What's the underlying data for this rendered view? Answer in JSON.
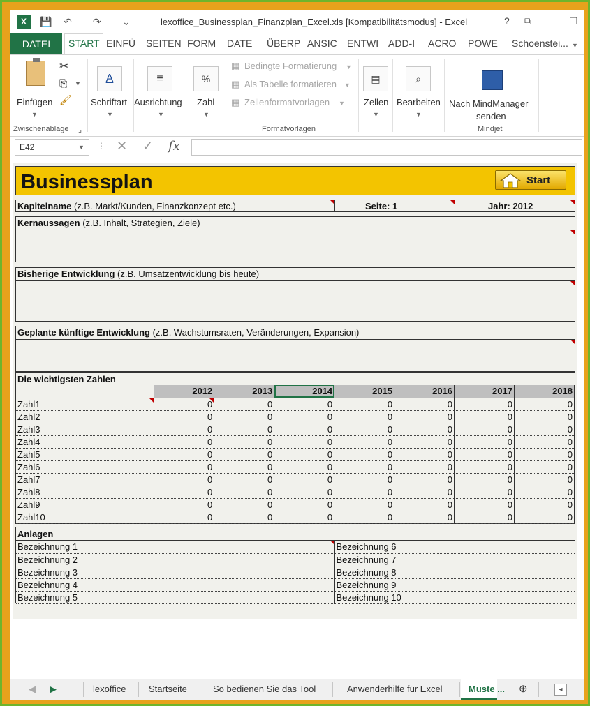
{
  "window": {
    "title": "lexoffice_Businessplan_Finanzplan_Excel.xls  [Kompatibilitätsmodus] - Excel",
    "logo_text": "X",
    "help": "?",
    "restore": "⧉",
    "minimize": "—",
    "maximize": "☐"
  },
  "quick_access": {
    "save": "💾",
    "undo": "↶",
    "redo": "↷",
    "more": "⌄"
  },
  "ribbon_tabs": [
    "DATEI",
    "START",
    "EINFÜ",
    "SEITEN",
    "FORM",
    "DATE",
    "ÜBERP",
    "ANSIC",
    "ENTWI",
    "ADD-I",
    "ACRO",
    "POWE"
  ],
  "account": "Schoenstei...",
  "ribbon": {
    "paste": "Einfügen",
    "clipboard_group": "Zwischenablage",
    "font": "Schriftart",
    "alignment": "Ausrichtung",
    "number": "Zahl",
    "cond_format": "Bedingte Formatierung",
    "as_table": "Als Tabelle formatieren",
    "cell_styles": "Zellenformatvorlagen",
    "styles_group": "Formatvorlagen",
    "cells": "Zellen",
    "edit": "Bearbeiten",
    "mindmanager_line1": "Nach MindManager",
    "mindmanager_line2": "senden",
    "mindjet_group": "Mindjet"
  },
  "formula_bar": {
    "name_box": "E42",
    "cancel": "✕",
    "enter": "✓",
    "fx": "fx",
    "value": ""
  },
  "sheet": {
    "title": "Businessplan",
    "start_button": "Start",
    "kapitel_label": "Kapitelname",
    "kapitel_hint": "(z.B. Markt/Kunden, Finanzkonzept etc.)",
    "seite": "Seite: 1",
    "jahr": "Jahr: 2012",
    "kern_label": "Kernaussagen",
    "kern_hint": "(z.B. Inhalt, Strategien, Ziele)",
    "bisher_label": "Bisherige Entwicklung",
    "bisher_hint": "(z.B. Umsatzentwicklung bis heute)",
    "geplant_label": "Geplante künftige Entwicklung",
    "geplant_hint": "(z.B. Wachstumsraten, Veränderungen, Expansion)",
    "zahlen_title": "Die wichtigsten Zahlen",
    "years": [
      "2012",
      "2013",
      "2014",
      "2015",
      "2016",
      "2017",
      "2018"
    ],
    "rows": [
      {
        "label": "Zahl1",
        "values": [
          "0",
          "0",
          "0",
          "0",
          "0",
          "0",
          "0"
        ]
      },
      {
        "label": "Zahl2",
        "values": [
          "0",
          "0",
          "0",
          "0",
          "0",
          "0",
          "0"
        ]
      },
      {
        "label": "Zahl3",
        "values": [
          "0",
          "0",
          "0",
          "0",
          "0",
          "0",
          "0"
        ]
      },
      {
        "label": "Zahl4",
        "values": [
          "0",
          "0",
          "0",
          "0",
          "0",
          "0",
          "0"
        ]
      },
      {
        "label": "Zahl5",
        "values": [
          "0",
          "0",
          "0",
          "0",
          "0",
          "0",
          "0"
        ]
      },
      {
        "label": "Zahl6",
        "values": [
          "0",
          "0",
          "0",
          "0",
          "0",
          "0",
          "0"
        ]
      },
      {
        "label": "Zahl7",
        "values": [
          "0",
          "0",
          "0",
          "0",
          "0",
          "0",
          "0"
        ]
      },
      {
        "label": "Zahl8",
        "values": [
          "0",
          "0",
          "0",
          "0",
          "0",
          "0",
          "0"
        ]
      },
      {
        "label": "Zahl9",
        "values": [
          "0",
          "0",
          "0",
          "0",
          "0",
          "0",
          "0"
        ]
      },
      {
        "label": "Zahl10",
        "values": [
          "0",
          "0",
          "0",
          "0",
          "0",
          "0",
          "0"
        ]
      }
    ],
    "anlagen_title": "Anlagen",
    "anlagen_left": [
      "Bezeichnung 1",
      "Bezeichnung 2",
      "Bezeichnung 3",
      "Bezeichnung 4",
      "Bezeichnung 5"
    ],
    "anlagen_right": [
      "Bezeichnung 6",
      "Bezeichnung 7",
      "Bezeichnung 8",
      "Bezeichnung 9",
      "Bezeichnung 10"
    ]
  },
  "sheet_tabs": [
    "lexoffice",
    "Startseite",
    "So bedienen Sie das Tool",
    "Anwenderhilfe für Excel",
    "Muste ..."
  ],
  "tab_nav": {
    "prev": "◀",
    "next": "▶",
    "add": "⊕",
    "scroll_left": "◂"
  },
  "colors": {
    "excel_green": "#217346",
    "banner_yellow": "#f3c400",
    "frame_orange": "#e8a21c",
    "header_gray": "#bfbfbf"
  }
}
